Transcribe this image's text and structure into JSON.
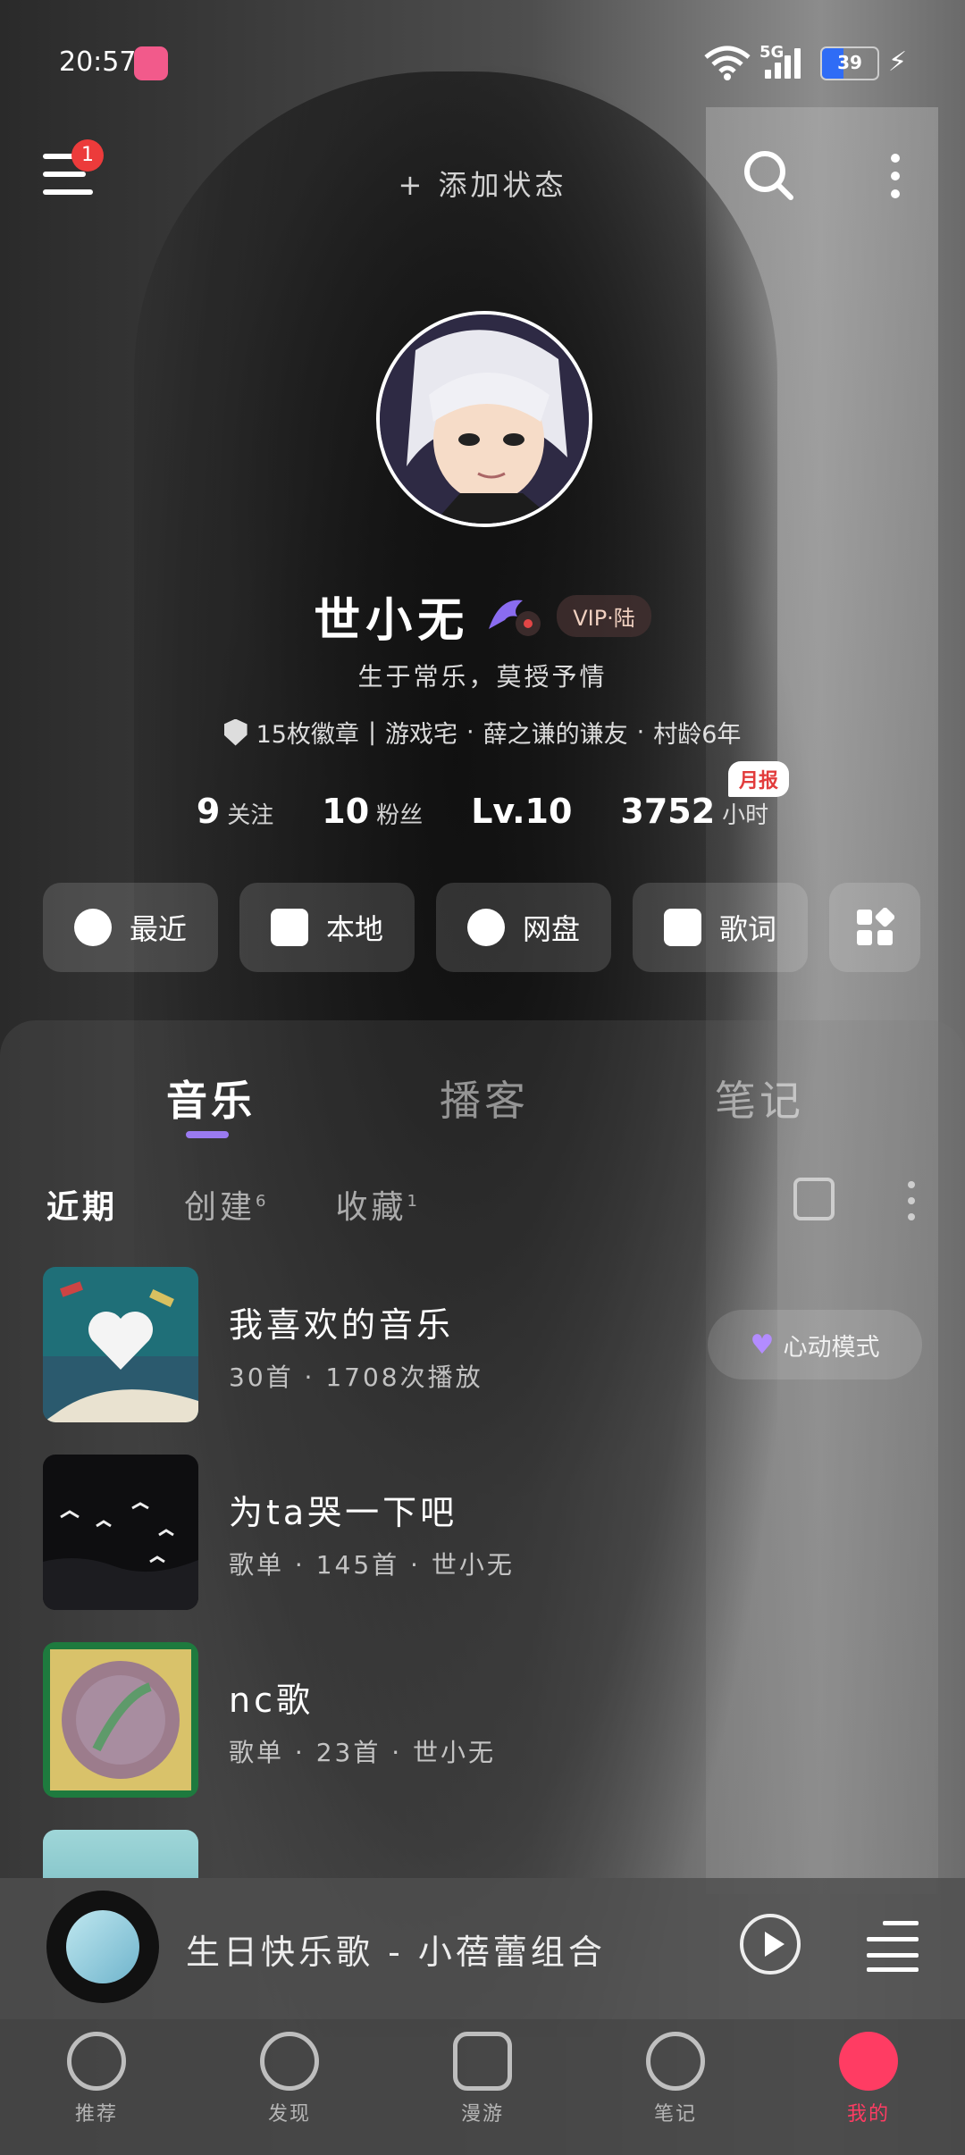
{
  "status_bar": {
    "time": "20:57",
    "network": "5G",
    "battery": "39",
    "battery_level": 0.39,
    "icons": [
      "bilibili-app-icon",
      "wifi-icon",
      "signal-icon",
      "battery-icon",
      "charging-icon"
    ]
  },
  "header": {
    "notification_count": "1",
    "add_status": "+ 添加状态",
    "icons": [
      "menu-icon",
      "search-icon",
      "more-icon"
    ]
  },
  "profile": {
    "username": "世小无",
    "vip_tag": "VIP·陆",
    "bio": "生于常乐，莫授予情",
    "badges": "15枚徽章",
    "tag_1": "游戏宅",
    "tag_2": "薛之谦的谦友",
    "tag_3": "村龄6年",
    "separator": "|",
    "dot": "·",
    "following_count": "9",
    "following_label": "关注",
    "followers_count": "10",
    "followers_label": "粉丝",
    "level": "Lv.10",
    "listen_hours": "3752",
    "listen_unit": "小时",
    "monthly_report": "月报"
  },
  "quick_actions": [
    {
      "label": "最近",
      "icon": "clock-icon"
    },
    {
      "label": "本地",
      "icon": "download-icon"
    },
    {
      "label": "网盘",
      "icon": "cloud-upload-icon"
    },
    {
      "label": "歌词",
      "icon": "lyrics-icon"
    },
    {
      "label": "",
      "icon": "apps-icon"
    }
  ],
  "tabs": [
    "音乐",
    "播客",
    "笔记"
  ],
  "subtabs": {
    "recent": "近期",
    "created": "创建",
    "created_count": "6",
    "collected": "收藏",
    "collected_count": "1"
  },
  "playlists": [
    {
      "title": "我喜欢的音乐",
      "subtitle": "30首 · 1708次播放"
    },
    {
      "title": "为ta哭一下吧",
      "subtitle": "歌单 · 145首 · 世小无"
    },
    {
      "title": "nc歌",
      "subtitle": "歌单 · 23首 · 世小无"
    }
  ],
  "heart_mode": "心动模式",
  "now_playing": {
    "song": "生日快乐歌 - 小蓓蕾组合"
  },
  "bottom_nav": [
    {
      "label": "推荐",
      "icon": "netease-logo-icon"
    },
    {
      "label": "发现",
      "icon": "compass-icon"
    },
    {
      "label": "漫游",
      "icon": "radio-icon"
    },
    {
      "label": "笔记",
      "icon": "chat-bubble-icon"
    },
    {
      "label": "我的",
      "icon": "profile-vip-icon",
      "active": true
    }
  ],
  "colors": {
    "accent": "#ff3c63",
    "tab_indicator": "#9a7af0",
    "battery": "#2f6cf6",
    "vip_purple": "#b38cff"
  }
}
